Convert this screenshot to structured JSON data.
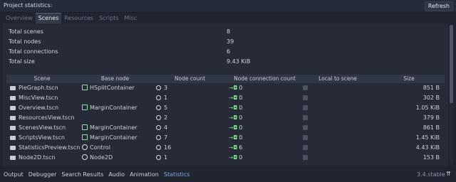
{
  "window": {
    "title": "Project statistics:",
    "refresh_label": "Refresh"
  },
  "tabs": [
    {
      "label": "Overview",
      "active": false
    },
    {
      "label": "Scenes",
      "active": true
    },
    {
      "label": "Resources",
      "active": false
    },
    {
      "label": "Scripts",
      "active": false
    },
    {
      "label": "Misc",
      "active": false
    }
  ],
  "summary": [
    {
      "label": "Total scenes",
      "value": "8"
    },
    {
      "label": "Total nodes",
      "value": "39"
    },
    {
      "label": "Total connections",
      "value": "6"
    },
    {
      "label": "Total size",
      "value": "9.43 KiB"
    }
  ],
  "table": {
    "headers": [
      "Scene",
      "Base node",
      "Node count",
      "Node connection count",
      "Local to scene",
      "Size"
    ],
    "rows": [
      {
        "scene": "PieGraph.tscn",
        "base": "HSplitContainer",
        "base_icon": "container-icon",
        "nodes": "3",
        "conns": "0",
        "size": "851 B"
      },
      {
        "scene": "MiscView.tscn",
        "base": "",
        "base_icon": "",
        "nodes": "1",
        "conns": "0",
        "size": "302 B"
      },
      {
        "scene": "Overview.tscn",
        "base": "MarginContainer",
        "base_icon": "container-icon",
        "nodes": "5",
        "conns": "0",
        "size": "1.05 KiB"
      },
      {
        "scene": "ResourcesView.tscn",
        "base": "",
        "base_icon": "",
        "nodes": "2",
        "conns": "0",
        "size": "379 B"
      },
      {
        "scene": "ScenesView.tscn",
        "base": "MarginContainer",
        "base_icon": "container-icon",
        "nodes": "4",
        "conns": "0",
        "size": "861 B"
      },
      {
        "scene": "ScriptsView.tscn",
        "base": "MarginContainer",
        "base_icon": "container-icon",
        "nodes": "7",
        "conns": "0",
        "size": "1.45 KiB"
      },
      {
        "scene": "StatisticsPreview.tscn",
        "base": "Control",
        "base_icon": "control-icon",
        "nodes": "16",
        "conns": "6",
        "size": "4.43 KiB"
      },
      {
        "scene": "Node2D.tscn",
        "base": "Node2D",
        "base_icon": "node2d-icon",
        "nodes": "1",
        "conns": "0",
        "size": "153 B"
      }
    ]
  },
  "bottom_tabs": [
    {
      "label": "Output",
      "active": false
    },
    {
      "label": "Debugger",
      "active": false
    },
    {
      "label": "Search Results",
      "active": false
    },
    {
      "label": "Audio",
      "active": false
    },
    {
      "label": "Animation",
      "active": false
    },
    {
      "label": "Statistics",
      "active": true
    }
  ],
  "version": "3.4.stable",
  "colors": {
    "accent": "#83a8e9",
    "container_icon": "#8fe3a2",
    "signal_arrow": "#7ee08e"
  }
}
